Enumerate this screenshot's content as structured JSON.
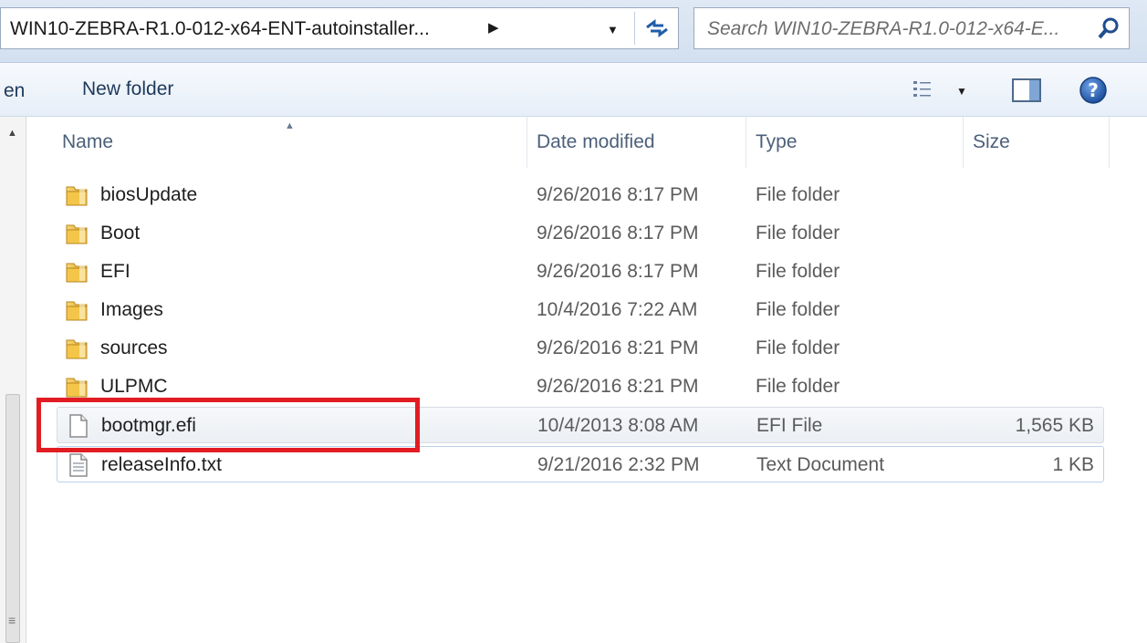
{
  "address_bar": {
    "path": "WIN10-ZEBRA-R1.0-012-x64-ENT-autoinstaller...",
    "search_placeholder": "Search WIN10-ZEBRA-R1.0-012-x64-E..."
  },
  "command_bar": {
    "open_label": "en",
    "new_folder_label": "New folder"
  },
  "columns": {
    "name": "Name",
    "date_modified": "Date modified",
    "type": "Type",
    "size": "Size"
  },
  "files": [
    {
      "name": "biosUpdate",
      "date": "9/26/2016 8:17 PM",
      "type": "File folder",
      "size": "",
      "icon": "folder-icon"
    },
    {
      "name": "Boot",
      "date": "9/26/2016 8:17 PM",
      "type": "File folder",
      "size": "",
      "icon": "folder-icon"
    },
    {
      "name": "EFI",
      "date": "9/26/2016 8:17 PM",
      "type": "File folder",
      "size": "",
      "icon": "folder-icon"
    },
    {
      "name": "Images",
      "date": "10/4/2016 7:22 AM",
      "type": "File folder",
      "size": "",
      "icon": "folder-icon"
    },
    {
      "name": "sources",
      "date": "9/26/2016 8:21 PM",
      "type": "File folder",
      "size": "",
      "icon": "folder-icon"
    },
    {
      "name": "ULPMC",
      "date": "9/26/2016 8:21 PM",
      "type": "File folder",
      "size": "",
      "icon": "folder-icon"
    },
    {
      "name": "bootmgr.efi",
      "date": "10/4/2013 8:08 AM",
      "type": "EFI File",
      "size": "1,565 KB",
      "icon": "blank-file-icon"
    },
    {
      "name": "releaseInfo.txt",
      "date": "9/21/2016 2:32 PM",
      "type": "Text Document",
      "size": "1 KB",
      "icon": "text-file-icon"
    }
  ],
  "colors": {
    "highlight": "#e21c23",
    "folder": "#e8b93c",
    "header_text": "#4c607a"
  }
}
